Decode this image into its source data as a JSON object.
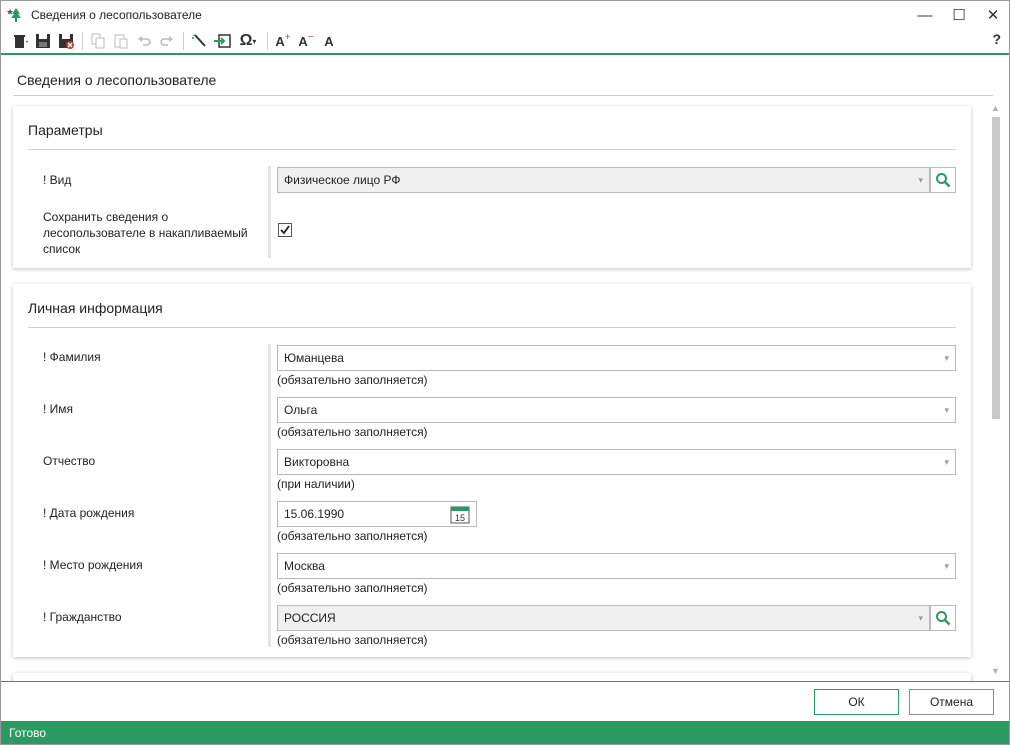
{
  "window": {
    "title": "Сведения о лесопользователе",
    "controls": {
      "minimize": "—",
      "maximize": "☐",
      "close": "✕"
    }
  },
  "toolbar": {
    "icons": [
      "trash-icon",
      "save-icon",
      "save-close-icon",
      "copy-icon",
      "paste-icon",
      "undo-icon",
      "redo-icon",
      "magic-wand-icon",
      "import-icon",
      "omega-symbol-icon",
      "font-increase-icon",
      "font-decrease-icon",
      "font-reset-icon"
    ],
    "help": "?"
  },
  "page": {
    "title": "Сведения о лесопользователе"
  },
  "params": {
    "heading": "Параметры",
    "vid_label": "! Вид",
    "vid_value": "Физическое лицо РФ",
    "save_label": "Сохранить сведения о лесопользователе в накапливаемый список",
    "save_checked": true
  },
  "personal": {
    "heading": "Личная информация",
    "fields": [
      {
        "label": "! Фамилия",
        "value": "Юманцева",
        "hint": "(обязательно заполняется)"
      },
      {
        "label": "! Имя",
        "value": "Ольга",
        "hint": "(обязательно заполняется)"
      },
      {
        "label": "Отчество",
        "value": "Викторовна",
        "hint": "(при наличии)"
      },
      {
        "label": "! Дата рождения",
        "value": "15.06.1990",
        "hint": "(обязательно заполняется)"
      },
      {
        "label": "! Место рождения",
        "value": "Москва",
        "hint": "(обязательно заполняется)"
      },
      {
        "label": "! Гражданство",
        "value": "РОССИЯ",
        "hint": "(обязательно заполняется)"
      }
    ]
  },
  "calendar_day": "15",
  "buttons": {
    "ok": "ОК",
    "cancel": "Отмена"
  },
  "status": "Готово",
  "colors": {
    "accent": "#2b9a62"
  }
}
